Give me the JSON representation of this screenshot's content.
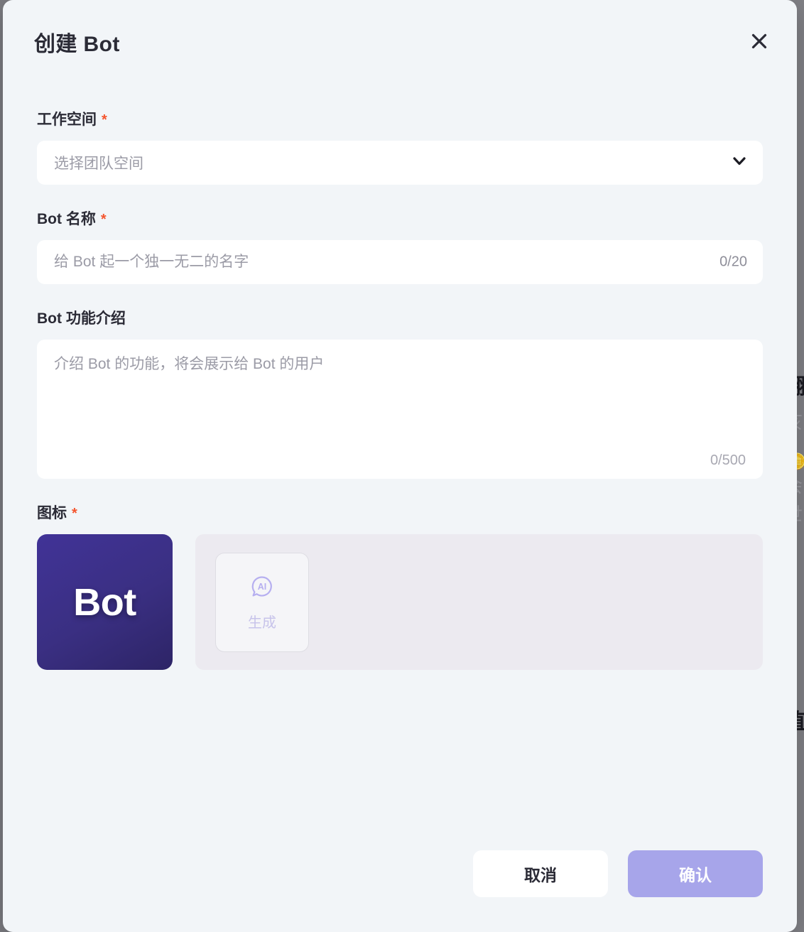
{
  "dialog": {
    "title": "创建 Bot",
    "close_icon": "close-icon"
  },
  "workspace": {
    "label": "工作空间",
    "required_mark": "*",
    "placeholder": "选择团队空间",
    "value": "",
    "chevron_icon": "chevron-down-icon"
  },
  "bot_name": {
    "label": "Bot 名称",
    "required_mark": "*",
    "placeholder": "给 Bot 起一个独一无二的名字",
    "value": "",
    "counter": "0/20"
  },
  "bot_description": {
    "label": "Bot 功能介绍",
    "placeholder": "介绍 Bot 的功能，将会展示给 Bot 的用户",
    "value": "",
    "counter": "0/500"
  },
  "icon_section": {
    "label": "图标",
    "required_mark": "*",
    "avatar_text": "Bot",
    "generate_icon": "ai-bubble-icon",
    "generate_label": "生成"
  },
  "footer": {
    "cancel_label": "取消",
    "confirm_label": "确认"
  },
  "colors": {
    "modal_bg": "#f2f5f8",
    "accent_purple": "#a7a5ea",
    "avatar_purple": "#3a2f82",
    "required_red": "#f4552e",
    "ai_icon_purple": "#b6aff0",
    "text_primary": "#2b2b36",
    "placeholder": "#9b9ba6"
  },
  "background": {
    "glyphs": [
      "翻",
      "植"
    ],
    "faint_glyphs": [
      "亥",
      "会",
      "世"
    ],
    "emoji": "🪙"
  }
}
